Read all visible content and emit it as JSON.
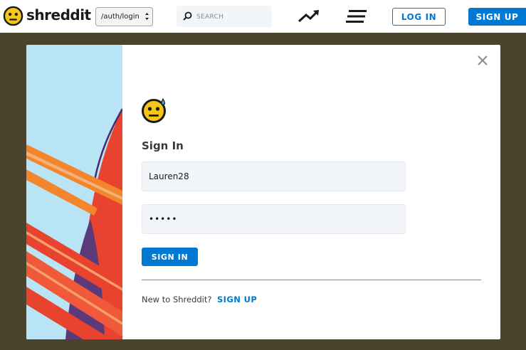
{
  "header": {
    "logo_text": "shreddit",
    "path_select": {
      "value": "/auth/login"
    },
    "search": {
      "placeholder": "SEARCH"
    },
    "login_label": "LOG IN",
    "signup_label": "SIGN UP",
    "icons": [
      "trending-icon",
      "menu-icon"
    ]
  },
  "modal": {
    "title": "Sign In",
    "username_value": "Lauren28",
    "password_value": "•••••",
    "submit_label": "SIGN IN",
    "new_user_text": "New to Shreddit?",
    "signup_link": "SIGN UP",
    "close_icon": "close-icon"
  },
  "colors": {
    "accent": "#0079d3",
    "overlay": "#4a432e",
    "input_bg": "#f2f6fb",
    "logo_yellow": "#f5c518",
    "art_sky": "#b8e4f5",
    "art_red": "#e8432e",
    "art_orange": "#f3862d",
    "art_purple": "#5a3a7a"
  }
}
